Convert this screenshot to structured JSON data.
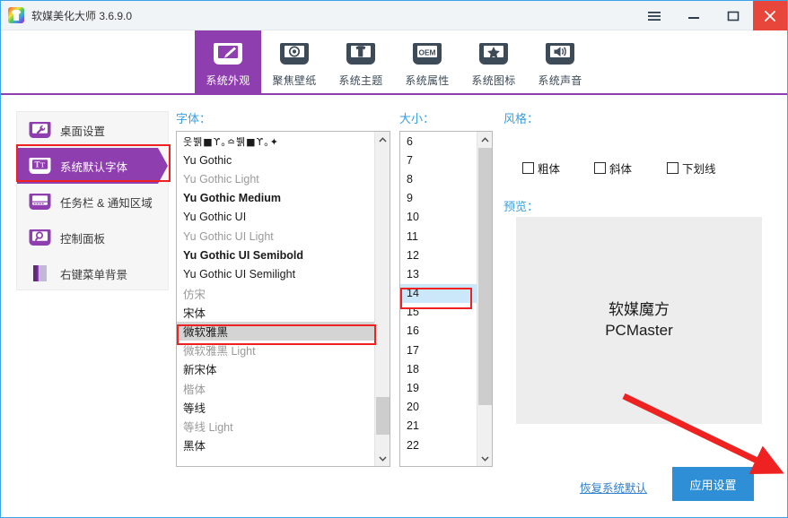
{
  "window": {
    "title": "软媒美化大师 3.6.9.0",
    "app_icon": "tshirt-rainbow-icon",
    "controls": {
      "menu": "menu-icon",
      "minimize": "minimize-icon",
      "maximize": "maximize-icon",
      "close": "close-icon"
    },
    "accent_purple": "#8e3eae",
    "accent_blue": "#2e8ed6",
    "annotation_red": "#ef2222",
    "close_red": "#e8463a"
  },
  "tabs": [
    {
      "label": "系统外观",
      "icon": "brush-monitor-icon",
      "active": true
    },
    {
      "label": "聚焦壁纸",
      "icon": "spotlight-monitor-icon",
      "active": false
    },
    {
      "label": "系统主题",
      "icon": "tshirt-monitor-icon",
      "active": false
    },
    {
      "label": "系统属性",
      "icon": "oem-monitor-icon",
      "active": false
    },
    {
      "label": "系统图标",
      "icon": "star-monitor-icon",
      "active": false
    },
    {
      "label": "系统声音",
      "icon": "speaker-monitor-icon",
      "active": false
    }
  ],
  "sidebar": {
    "items": [
      {
        "label": "桌面设置",
        "icon": "wrench-monitor-icon",
        "selected": false
      },
      {
        "label": "系统默认字体",
        "icon": "text-monitor-icon",
        "selected": true
      },
      {
        "label": "任务栏 & 通知区域",
        "icon": "taskbar-icon",
        "selected": false
      },
      {
        "label": "控制面板",
        "icon": "magnifier-monitor-icon",
        "selected": false
      },
      {
        "label": "右键菜单背景",
        "icon": "context-menu-icon",
        "selected": false
      }
    ]
  },
  "font_panel": {
    "label": "字体：",
    "items": [
      {
        "name": "웃뷁■ϒ｡≏뷁■ϒ｡✦",
        "style": "symbol",
        "selected": false
      },
      {
        "name": "Yu Gothic",
        "style": "normal",
        "selected": false
      },
      {
        "name": "Yu Gothic Light",
        "style": "light",
        "selected": false
      },
      {
        "name": "Yu Gothic Medium",
        "style": "bold",
        "selected": false
      },
      {
        "name": "Yu Gothic UI",
        "style": "normal",
        "selected": false
      },
      {
        "name": "Yu Gothic UI Light",
        "style": "light",
        "selected": false
      },
      {
        "name": "Yu Gothic UI Semibold",
        "style": "bold",
        "selected": false
      },
      {
        "name": "Yu Gothic UI Semilight",
        "style": "normal",
        "selected": false
      },
      {
        "name": "仿宋",
        "style": "light",
        "selected": false
      },
      {
        "name": "宋体",
        "style": "normal",
        "selected": false
      },
      {
        "name": "微软雅黑",
        "style": "normal",
        "selected": true
      },
      {
        "name": "微软雅黑 Light",
        "style": "light",
        "selected": false
      },
      {
        "name": "新宋体",
        "style": "normal",
        "selected": false
      },
      {
        "name": "楷体",
        "style": "light",
        "selected": false
      },
      {
        "name": "等线",
        "style": "normal",
        "selected": false
      },
      {
        "name": "等线 Light",
        "style": "light",
        "selected": false
      },
      {
        "name": "黑体",
        "style": "normal",
        "selected": false
      }
    ],
    "selected_value": "微软雅黑",
    "scroll_up_icon": "chevron-up-icon",
    "scroll_down_icon": "chevron-down-icon"
  },
  "size_panel": {
    "label": "大小：",
    "items": [
      "6",
      "7",
      "8",
      "9",
      "10",
      "11",
      "12",
      "13",
      "14",
      "15",
      "16",
      "17",
      "18",
      "19",
      "20",
      "21",
      "22"
    ],
    "selected_value": "14",
    "scroll_up_icon": "chevron-up-icon",
    "scroll_down_icon": "chevron-down-icon"
  },
  "style_panel": {
    "label": "风格：",
    "checkboxes": [
      {
        "label": "粗体",
        "checked": false
      },
      {
        "label": "斜体",
        "checked": false
      },
      {
        "label": "下划线",
        "checked": false
      }
    ]
  },
  "preview_panel": {
    "label": "预览：",
    "line1": "软媒魔方",
    "line2": "PCMaster"
  },
  "actions": {
    "restore_default": "恢复系统默认",
    "apply": "应用设置"
  }
}
